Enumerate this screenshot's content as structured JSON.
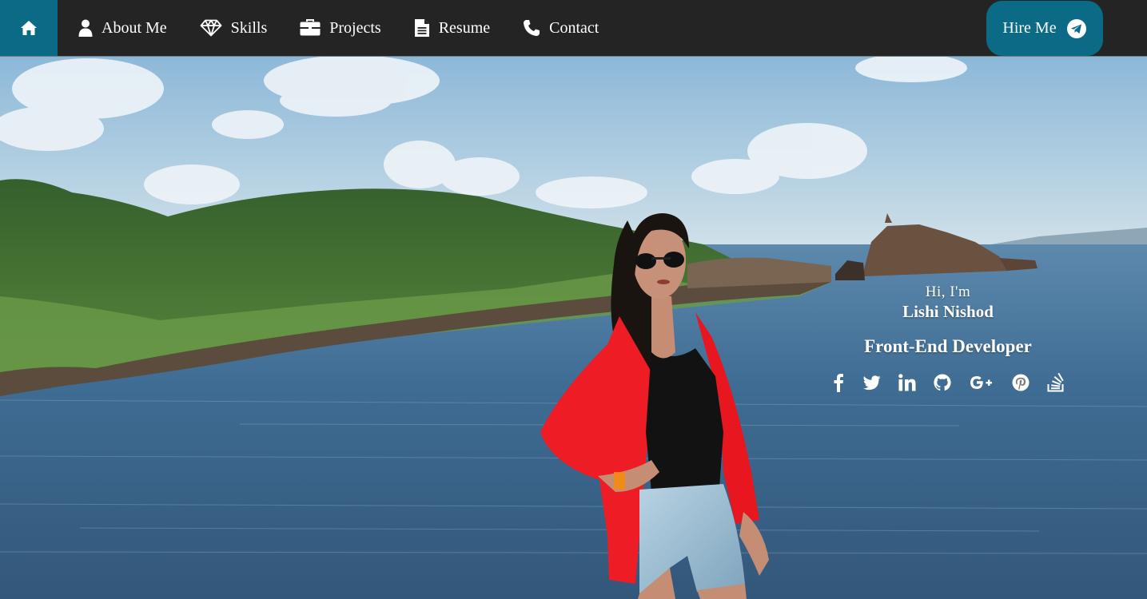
{
  "nav": {
    "home_icon": "home-icon",
    "items": [
      {
        "label": "About Me",
        "icon": "user-icon"
      },
      {
        "label": "Skills",
        "icon": "diamond-icon"
      },
      {
        "label": "Projects",
        "icon": "briefcase-icon"
      },
      {
        "label": "Resume",
        "icon": "document-icon"
      },
      {
        "label": "Contact",
        "icon": "phone-icon"
      }
    ],
    "hire": {
      "label": "Hire Me",
      "icon": "telegram-icon"
    }
  },
  "hero": {
    "greeting": "Hi, I'm",
    "name": "Lishi Nishod",
    "role": "Front-End Developer",
    "socials": [
      "facebook-icon",
      "twitter-icon",
      "linkedin-icon",
      "github-icon",
      "google-plus-icon",
      "pinterest-icon",
      "stack-overflow-icon"
    ]
  },
  "colors": {
    "accent": "#0b6a86",
    "navbar": "#242424",
    "text": "#ffffff"
  }
}
